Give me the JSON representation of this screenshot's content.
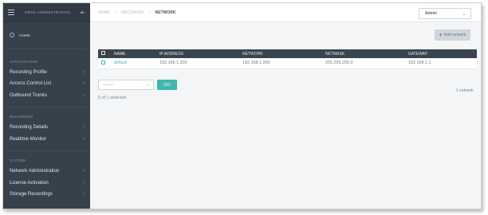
{
  "sidebar": {
    "title": "RBOS ADMINISTRATION",
    "home_label": "HOME",
    "sections": [
      {
        "label": "APPLICATIONS",
        "items": [
          {
            "label": "Recording Profile"
          },
          {
            "label": "Access Control List"
          },
          {
            "label": "Outbound Trunks"
          }
        ]
      },
      {
        "label": "RECORDING",
        "items": [
          {
            "label": "Recording Details"
          },
          {
            "label": "Realtime Monitor"
          }
        ]
      },
      {
        "label": "SYSTEM",
        "items": [
          {
            "label": "Network Administration"
          },
          {
            "label": "License Activation"
          },
          {
            "label": "Storage Recordings"
          }
        ]
      }
    ]
  },
  "breadcrumb": [
    "HOME",
    "RECORDER",
    "NETWORK"
  ],
  "user_menu": {
    "selected": "Admin"
  },
  "toolbar": {
    "add_label": "Add network"
  },
  "table": {
    "columns": [
      "NAME",
      "IP ADDRESS",
      "NETWORK",
      "NETMASK",
      "GATEWAY"
    ],
    "rows": [
      {
        "name": "default",
        "ip_address": "192.168.1.200",
        "network": "192.168.1.255",
        "netmask": "255.255.255.0",
        "gateway": "192.168.1.1"
      }
    ]
  },
  "bulk_action": {
    "placeholder": "--------",
    "go_label": "GO"
  },
  "selection_text": "0 of 1 selected",
  "count_text": "1 network",
  "colors": {
    "sidebar_bg": "#37414c",
    "accent": "#3fb8ae",
    "header_bg": "#3a444f",
    "chevron": "#4aa3df"
  }
}
